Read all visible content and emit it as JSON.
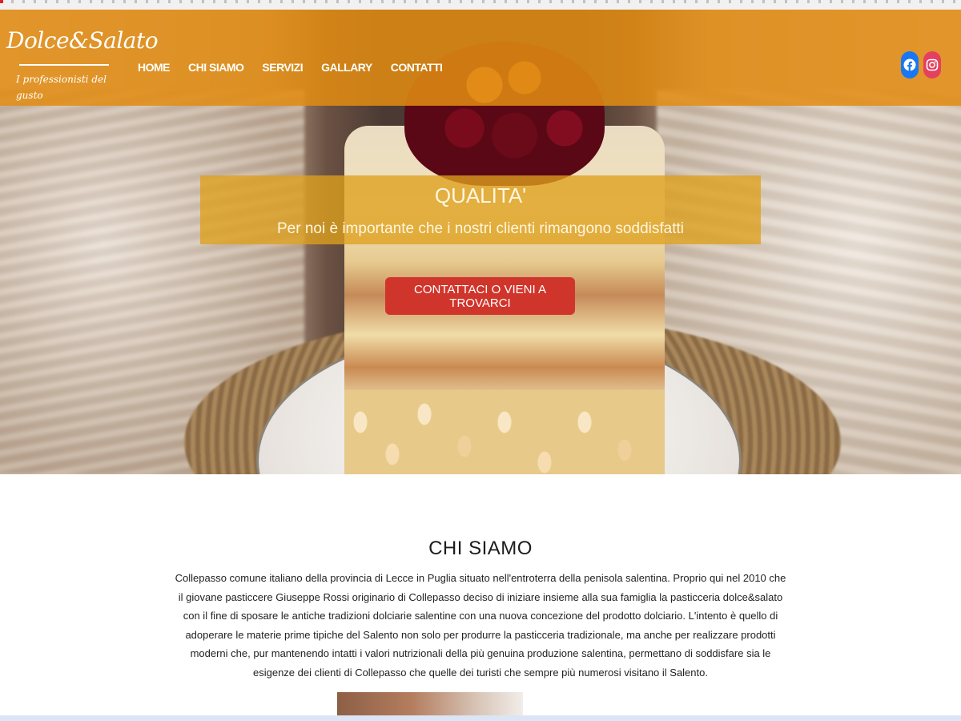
{
  "brand": {
    "name": "Dolce&Salato",
    "tagline": "I professionisti del gusto"
  },
  "nav": {
    "items": [
      "HOME",
      "CHI SIAMO",
      "SERVIZI",
      "GALLARY",
      "CONTATTI"
    ]
  },
  "social": {
    "icons": [
      "facebook-icon",
      "instagram-icon"
    ],
    "colors": {
      "facebook": "#1877f2",
      "instagram": "#e4405f"
    }
  },
  "hero": {
    "title": "QUALITA'",
    "subtitle": "Per noi è importante che i nostri clienti rimangono soddisfatti",
    "cta": "CONTATTACI O VIENI A TROVARCI"
  },
  "about": {
    "title": "CHI SIAMO",
    "text": "Collepasso comune italiano della provincia di Lecce in Puglia situato nell'entroterra della penisola salentina. Proprio qui nel 2010 che il giovane pasticcere Giuseppe Rossi originario di Collepasso deciso di iniziare insieme alla sua famiglia la pasticceria dolce&salato con il fine di sposare le antiche tradizioni dolciarie salentine con una nuova concezione del prodotto dolciario. L'intento è quello di adoperare le materie prime tipiche del Salento non solo per produrre la pasticceria tradizionale, ma anche per realizzare prodotti moderni che, pur mantenendo intatti i valori nutrizionali della più genuina produzione salentina, permettano di soddisfare sia le esigenze dei clienti di Collepasso che quelle dei turisti che sempre più numerosi visitano il Salento."
  },
  "theme": {
    "header_color": "#e28c12",
    "cta_color": "#d0352b",
    "banner_color": "#dea01c"
  }
}
